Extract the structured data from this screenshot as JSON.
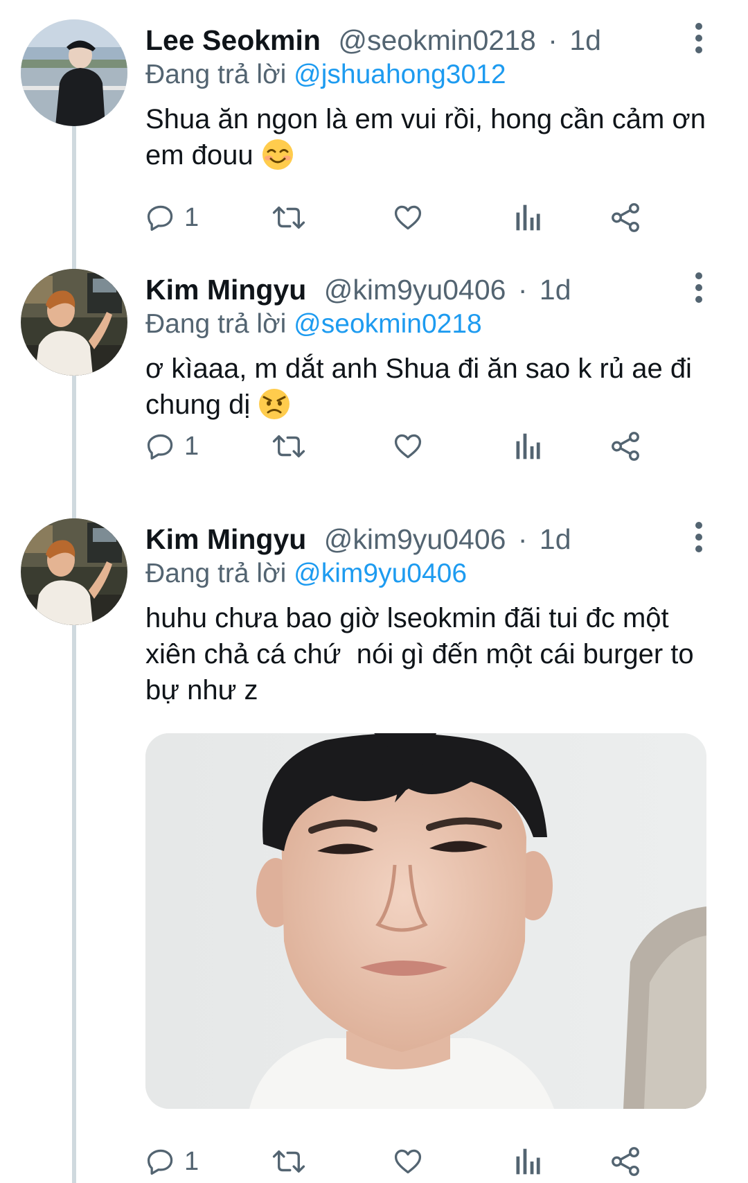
{
  "tweets": [
    {
      "display_name": "Lee Seokmin",
      "handle": "@seokmin0218",
      "separator": "·",
      "time": "1d",
      "replying_prefix": "Đang trả lời",
      "replying_to": "@jshuahong3012",
      "text": "Shua ăn ngon là em vui rồi, hong cần cảm ơn em đouu",
      "emoji": "smiling-blush-emoji",
      "reply_count": "1"
    },
    {
      "display_name": "Kim Mingyu",
      "handle": "@kim9yu0406",
      "separator": "·",
      "time": "1d",
      "replying_prefix": "Đang trả lời",
      "replying_to": "@seokmin0218",
      "text": "ơ kìaaa, m dắt anh Shua đi ăn sao k rủ ae đi chung dị",
      "emoji": "angry-face-emoji",
      "reply_count": "1"
    },
    {
      "display_name": "Kim Mingyu",
      "handle": "@kim9yu0406",
      "separator": "·",
      "time": "1d",
      "replying_prefix": "Đang trả lời",
      "replying_to": "@kim9yu0406",
      "text": "huhu chưa bao giờ lseokmin đãi tui đc một xiên chả cá chứ  nói gì đến một cái burger to bự như z",
      "media": "photo-of-young-man-sad-face",
      "reply_count": "1"
    }
  ],
  "colors": {
    "link": "#1d9bf0",
    "secondary_text": "#536471",
    "thread_line": "#cfd9de",
    "icon": "#536471"
  },
  "icons": [
    "reply-icon",
    "retweet-icon",
    "like-icon",
    "views-icon",
    "share-icon",
    "more-icon"
  ]
}
